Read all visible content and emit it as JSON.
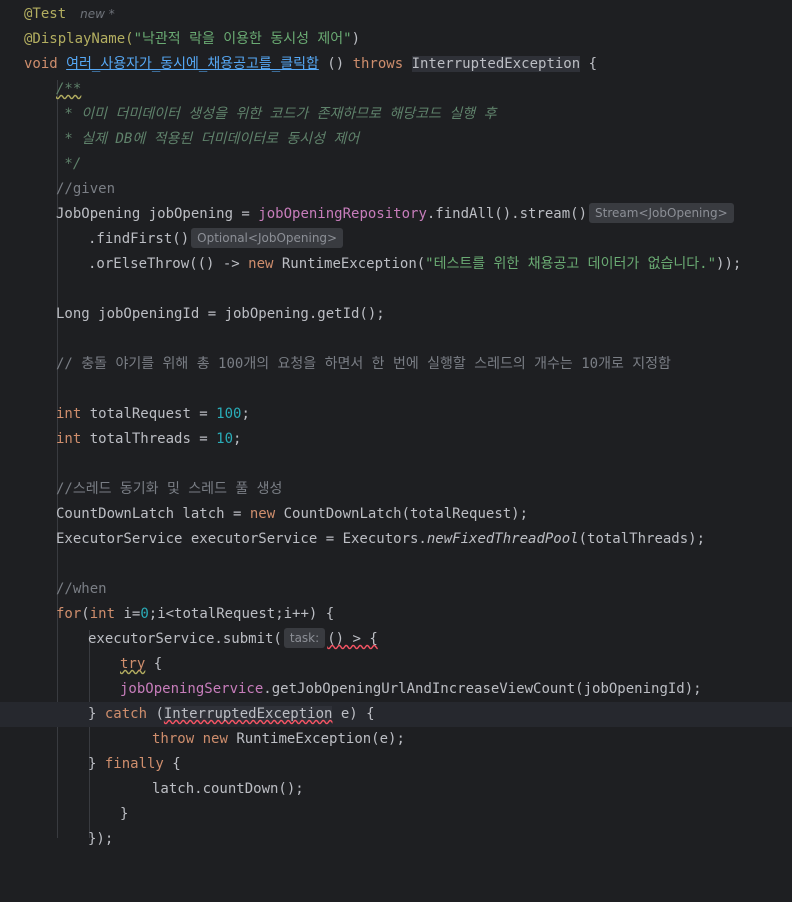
{
  "lines": {
    "l1": {
      "annotation": "@Test",
      "author_hint": "new *"
    },
    "l2": {
      "annotation": "@DisplayName(",
      "string": "\"낙관적 락을 이용한 동시성 제어\"",
      "close": ")"
    },
    "l3": {
      "kw_void": "void",
      "method_name": "여러_사용자가_동시에_채용공고를_클릭함",
      "params": " () ",
      "kw_throws": "throws",
      "exception": "InterruptedException",
      "brace": " {"
    },
    "l4": {
      "doc": "/**"
    },
    "l5": {
      "doc": " * 이미 더미데이터 생성을 위한 코드가 존재하므로 해당코드 실행 후"
    },
    "l6": {
      "doc": " * 실제 DB에 적용된 더미데이터로 동시성 제어"
    },
    "l7": {
      "doc": " */"
    },
    "l8": {
      "comment": "//given"
    },
    "l9": {
      "pre": "JobOpening jobOpening = ",
      "field": "jobOpeningRepository",
      "post": ".findAll().stream()",
      "hint": "Stream<JobOpening>"
    },
    "l10": {
      "pre": ".findFirst()",
      "hint": "Optional<JobOpening>"
    },
    "l11": {
      "pre": ".orElseThrow(() -> ",
      "kw_new": "new",
      "mid": " RuntimeException(",
      "string": "\"테스트를 위한 채용공고 데이터가 없습니다.\"",
      "post": "));"
    },
    "l13": {
      "text": "Long jobOpeningId = jobOpening.getId();"
    },
    "l15": {
      "comment": "// 충돌 야기를 위해 총 100개의 요청을 하면서 한 번에 실행할 스레드의 개수는 10개로 지정함"
    },
    "l17": {
      "kw": "int",
      "name": " totalRequest = ",
      "num": "100",
      "end": ";"
    },
    "l18": {
      "kw": "int",
      "name": " totalThreads = ",
      "num": "10",
      "end": ";"
    },
    "l20": {
      "comment": "//스레드 동기화 및 스레드 풀 생성"
    },
    "l21": {
      "pre": "CountDownLatch latch = ",
      "kw_new": "new",
      "post": " CountDownLatch(totalRequest);"
    },
    "l22": {
      "pre": "ExecutorService executorService = Executors.",
      "static_call": "newFixedThreadPool",
      "post": "(totalThreads);"
    },
    "l24": {
      "comment": "//when"
    },
    "l25": {
      "kw_for": "for",
      "p1": "(",
      "kw_int": "int",
      "p2": " i=",
      "num0": "0",
      "p3": ";i<totalRequest;i++) {"
    },
    "l26": {
      "pre": "executorService.submit(",
      "hint": "task:",
      "lambda": "() > {"
    },
    "l27": {
      "kw_try": "try",
      "post": " {"
    },
    "l28": {
      "field": "jobOpeningService",
      "post": ".getJobOpeningUrlAndIncreaseViewCount(jobOpeningId);"
    },
    "l29": {
      "pre": "} ",
      "kw_catch": "catch",
      "p2": " (",
      "exception": "InterruptedException",
      "post": " e) {"
    },
    "l30": {
      "kw_throw": "throw",
      "sp": " ",
      "kw_new": "new",
      "post": " RuntimeException(e);"
    },
    "l31": {
      "pre": "} ",
      "kw_finally": "finally",
      "post": " {"
    },
    "l32": {
      "text": "latch.countDown();"
    },
    "l33": {
      "text": "}"
    },
    "l34": {
      "text": "});"
    }
  },
  "colors": {
    "background": "#1e1f22",
    "keyword": "#cf8e6d",
    "string": "#6aab73",
    "annotation": "#b3ae60",
    "number": "#2aacb8",
    "field": "#c77dbb",
    "comment": "#7a7e85",
    "doc_comment": "#5f826b"
  }
}
